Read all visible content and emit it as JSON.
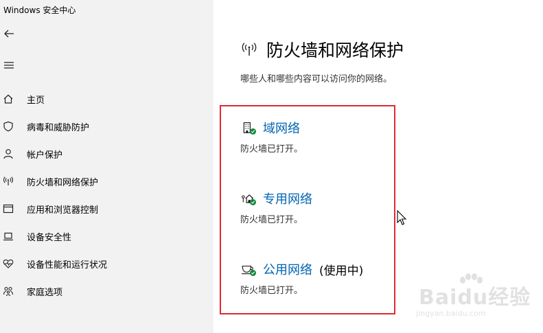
{
  "window": {
    "title": "Windows 安全中心"
  },
  "sidebar": {
    "items": [
      {
        "label": "主页",
        "icon": "home-icon"
      },
      {
        "label": "病毒和威胁防护",
        "icon": "shield-icon"
      },
      {
        "label": "帐户保护",
        "icon": "person-icon"
      },
      {
        "label": "防火墙和网络保护",
        "icon": "wireless-icon"
      },
      {
        "label": "应用和浏览器控制",
        "icon": "browser-window-icon"
      },
      {
        "label": "设备安全性",
        "icon": "laptop-icon"
      },
      {
        "label": "设备性能和运行状况",
        "icon": "heart-pulse-icon"
      },
      {
        "label": "家庭选项",
        "icon": "family-icon"
      }
    ]
  },
  "main": {
    "title": "防火墙和网络保护",
    "subtitle": "哪些人和哪些内容可以访问你的网络。",
    "networks": [
      {
        "name": "域网络",
        "status": "防火墙已打开。",
        "in_use": ""
      },
      {
        "name": "专用网络",
        "status": "防火墙已打开。",
        "in_use": ""
      },
      {
        "name": "公用网络",
        "status": "防火墙已打开。",
        "in_use": "(使用中)"
      }
    ]
  },
  "colors": {
    "sidebar_bg": "#f2f2f2",
    "link": "#0063b1",
    "ok_badge": "#10893e",
    "highlight_border": "#e0282e"
  },
  "watermark": {
    "logo_text": "Baidu经验",
    "url": "jingyan.baidu.com"
  }
}
